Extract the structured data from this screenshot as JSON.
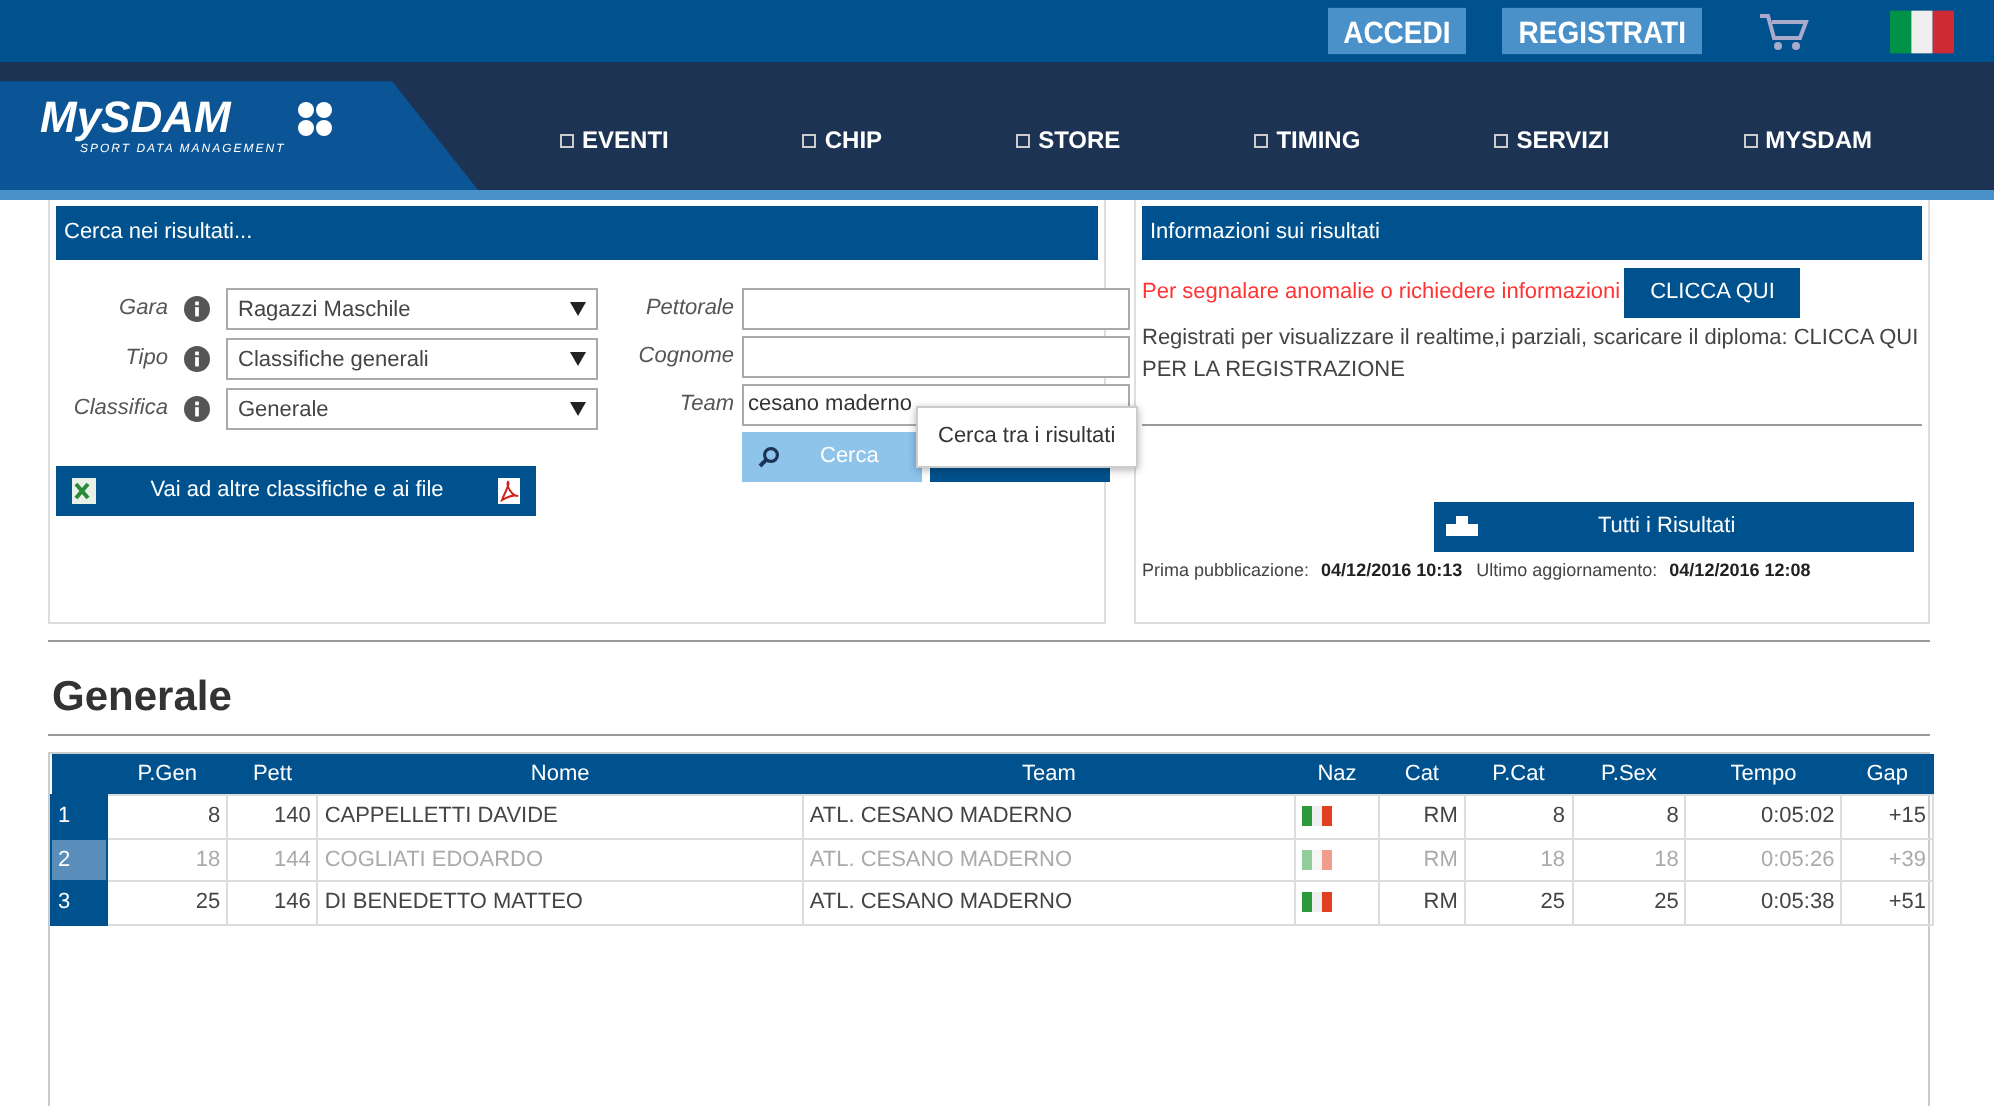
{
  "top_bar": {
    "buttons": [
      "ACCEDI",
      "REGISTRATI"
    ]
  },
  "nav": {
    "logo": "MySDAM",
    "logo_tagline": "SPORT DATA MANAGEMENT",
    "items": [
      "EVENTI",
      "CHIP",
      "STORE",
      "TIMING",
      "SERVIZI",
      "MYSDAM"
    ]
  },
  "search_panel": {
    "title": "Cerca nei risultati...",
    "selects": [
      {
        "label": "Gara",
        "value": "Ragazzi Maschile"
      },
      {
        "label": "Tipo",
        "value": "Classifiche generali"
      },
      {
        "label": "Classifica",
        "value": "Generale"
      }
    ],
    "fields": [
      {
        "label": "Pettorale"
      },
      {
        "label": "Cognome"
      },
      {
        "label": "Team",
        "value": "cesano maderno"
      }
    ],
    "search_button": "Cerca",
    "tooltip": "Cerca tra i risultati",
    "files_button": "Vai ad altre classifiche e ai file"
  },
  "info_panel": {
    "title": "Informazioni sui risultati",
    "report_text": "Per segnalare anomalie o richiedere informazioni",
    "report_button": "CLICCA QUI",
    "register_text": "Registrati per visualizzare il realtime,i parziali, scaricare il diploma: CLICCA QUI PER LA REGISTRAZIONE",
    "all_results_button": "Tutti i Risultati",
    "first_published_label": "Prima pubblicazione:",
    "first_published": "04/12/2016 10:13",
    "last_updated_label": "Ultimo aggiornamento:",
    "last_updated": "04/12/2016 12:08"
  },
  "heading": "Generale",
  "table": {
    "columns": [
      "P.Gen",
      "Pett",
      "Nome",
      "Team",
      "Naz",
      "Cat",
      "P.Cat",
      "P.Sex",
      "Tempo",
      "Gap"
    ],
    "rows": [
      {
        "index": "1",
        "highlighted": false,
        "cells": [
          "8",
          "140",
          "CAPPELLETTI DAVIDE",
          "ATL. CESANO MADERNO",
          "",
          "RM",
          "8",
          "8",
          "0:05:02",
          "+15"
        ]
      },
      {
        "index": "2",
        "highlighted": true,
        "cells": [
          "18",
          "144",
          "COGLIATI EDOARDO",
          "ATL. CESANO MADERNO",
          "",
          "RM",
          "18",
          "18",
          "0:05:26",
          "+39"
        ]
      },
      {
        "index": "3",
        "highlighted": false,
        "cells": [
          "25",
          "146",
          "DI BENEDETTO MATTEO",
          "ATL. CESANO MADERNO",
          "",
          "RM",
          "25",
          "25",
          "0:05:38",
          "+51"
        ]
      }
    ]
  }
}
